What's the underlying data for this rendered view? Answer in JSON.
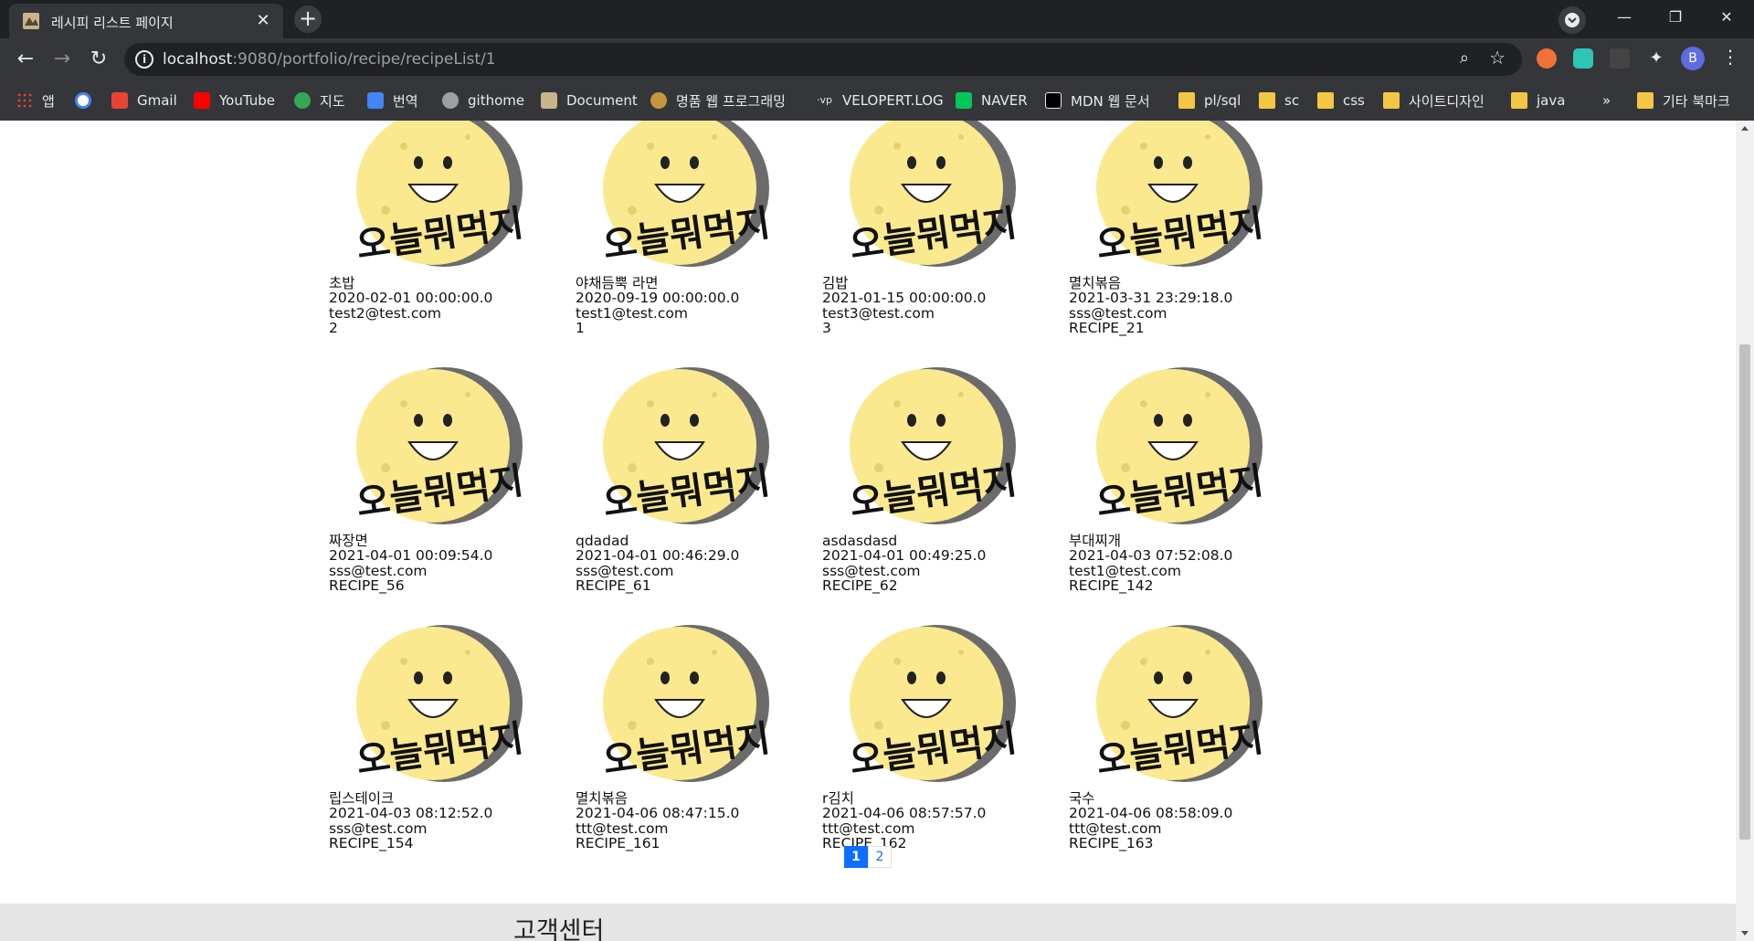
{
  "browser": {
    "tab_title": "레시피 리스트 페이지",
    "url_host": "localhost",
    "url_path": ":9080/portfolio/recipe/recipeList/1",
    "bookmarks": [
      {
        "label": "앱",
        "icon": "apps-grid-icon"
      },
      {
        "label": "",
        "icon": "google-icon"
      },
      {
        "label": "Gmail",
        "icon": "gmail-icon"
      },
      {
        "label": "YouTube",
        "icon": "youtube-icon"
      },
      {
        "label": "지도",
        "icon": "maps-icon"
      },
      {
        "label": "번역",
        "icon": "translate-icon"
      },
      {
        "label": "githome",
        "icon": "globe-icon"
      },
      {
        "label": "Document",
        "icon": "document-icon"
      },
      {
        "label": "명품 웹 프로그래밍",
        "icon": "site-icon"
      },
      {
        "label": "VELOPERT.LOG",
        "icon": "velopert-icon"
      },
      {
        "label": "NAVER",
        "icon": "naver-icon"
      },
      {
        "label": "MDN 웹 문서",
        "icon": "mdn-icon"
      },
      {
        "label": "pl/sql",
        "icon": "folder-icon"
      },
      {
        "label": "sc",
        "icon": "folder-icon"
      },
      {
        "label": "css",
        "icon": "folder-icon"
      },
      {
        "label": "사이트디자인",
        "icon": "folder-icon"
      },
      {
        "label": "java",
        "icon": "folder-icon"
      }
    ],
    "overflow_label": "»",
    "other_bookmarks": "기타 북마크",
    "profile_initial": "B"
  },
  "recipes": [
    {
      "name": "초밥",
      "date": "2020-02-01 00:00:00.0",
      "email": "test2@test.com",
      "id": "2"
    },
    {
      "name": "야채듬뿍 라면",
      "date": "2020-09-19 00:00:00.0",
      "email": "test1@test.com",
      "id": "1"
    },
    {
      "name": "김밥",
      "date": "2021-01-15 00:00:00.0",
      "email": "test3@test.com",
      "id": "3"
    },
    {
      "name": "멸치볶음",
      "date": "2021-03-31 23:29:18.0",
      "email": "sss@test.com",
      "id": "RECIPE_21"
    },
    {
      "name": "짜장면",
      "date": "2021-04-01 00:09:54.0",
      "email": "sss@test.com",
      "id": "RECIPE_56"
    },
    {
      "name": "qdadad",
      "date": "2021-04-01 00:46:29.0",
      "email": "sss@test.com",
      "id": "RECIPE_61"
    },
    {
      "name": "asdasdasd",
      "date": "2021-04-01 00:49:25.0",
      "email": "sss@test.com",
      "id": "RECIPE_62"
    },
    {
      "name": "부대찌개",
      "date": "2021-04-03 07:52:08.0",
      "email": "test1@test.com",
      "id": "RECIPE_142"
    },
    {
      "name": "립스테이크",
      "date": "2021-04-03 08:12:52.0",
      "email": "sss@test.com",
      "id": "RECIPE_154"
    },
    {
      "name": "멸치볶음",
      "date": "2021-04-06 08:47:15.0",
      "email": "ttt@test.com",
      "id": "RECIPE_161"
    },
    {
      "name": "r김치",
      "date": "2021-04-06 08:57:57.0",
      "email": "ttt@test.com",
      "id": "RECIPE_162"
    },
    {
      "name": "국수",
      "date": "2021-04-06 08:58:09.0",
      "email": "ttt@test.com",
      "id": "RECIPE_163"
    }
  ],
  "thumbnail_text": "오늘뭐먹지",
  "pagination": {
    "pages": [
      "1",
      "2"
    ],
    "current": "1"
  },
  "footer": {
    "title": "고객센터"
  },
  "colors": {
    "moon": "#fbe98f",
    "moon_shadow": "#6b6b6b",
    "accent": "#0d6efd"
  }
}
